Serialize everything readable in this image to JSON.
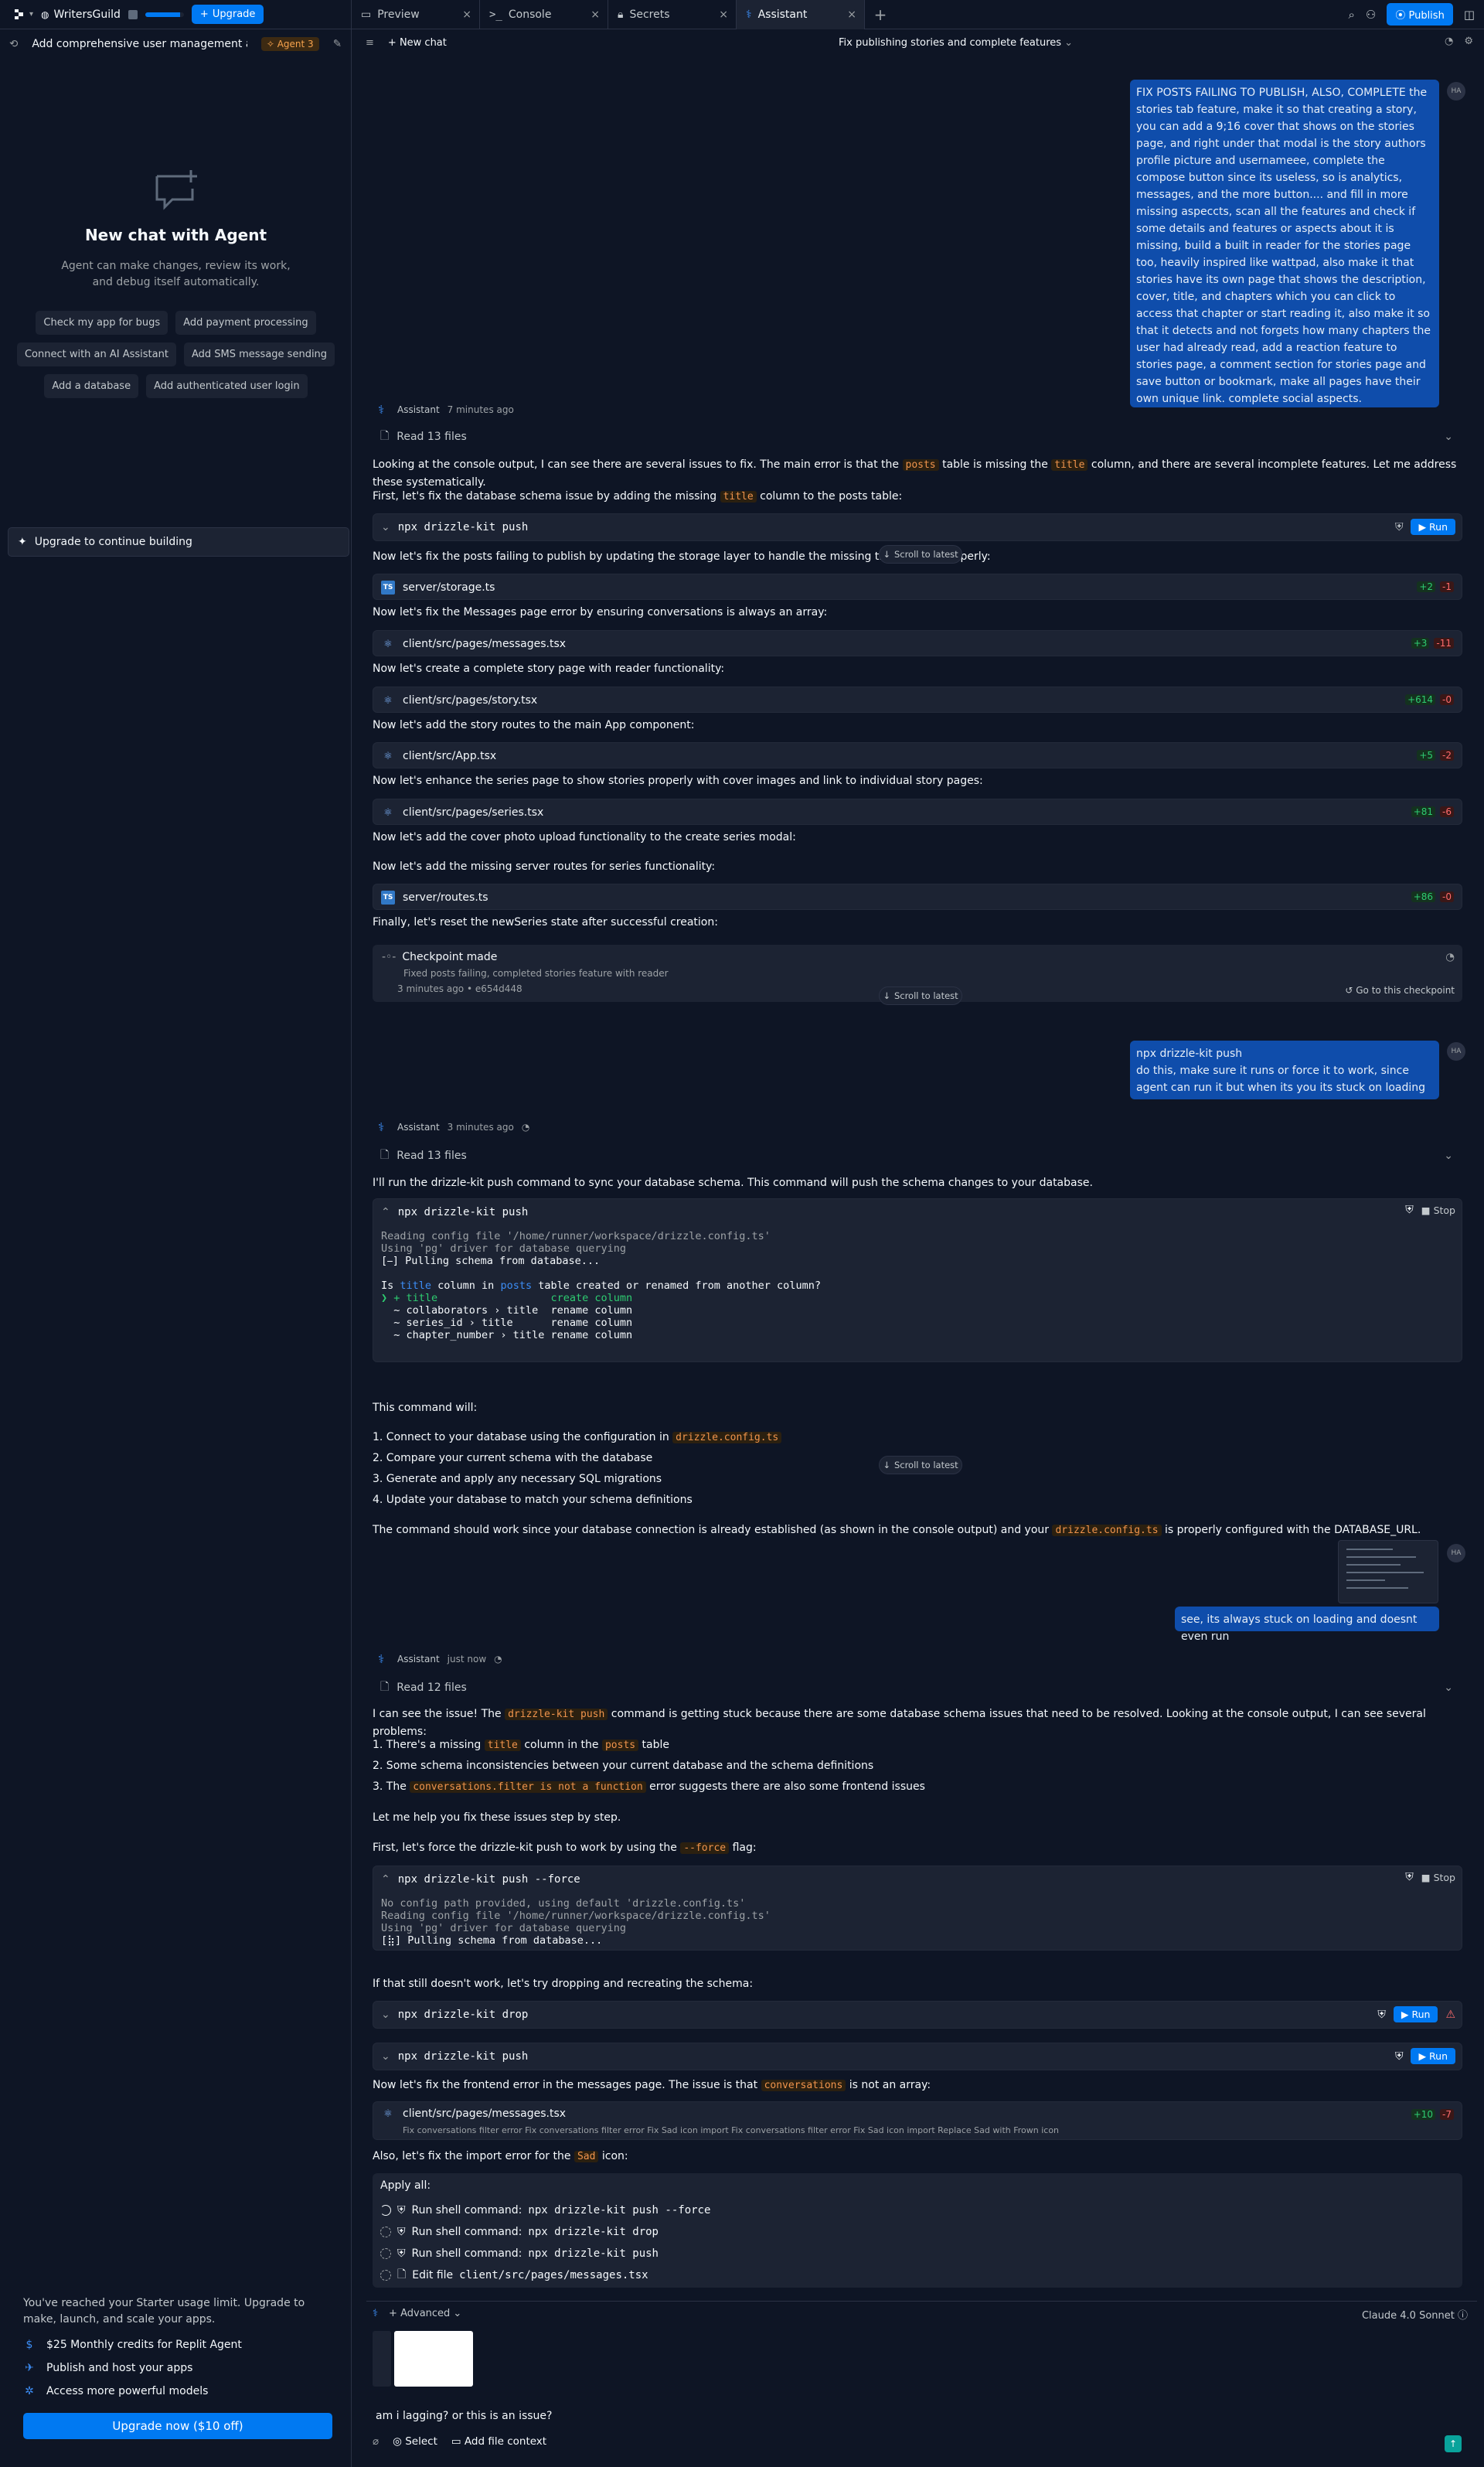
{
  "topbar": {
    "app_name": "WritersGuild",
    "upgrade_label": "Upgrade",
    "tabs": [
      {
        "label": "Preview",
        "icon": "preview-icon"
      },
      {
        "label": "Console",
        "icon": "terminal-icon"
      },
      {
        "label": "Secrets",
        "icon": "lock-icon"
      },
      {
        "label": "Assistant",
        "icon": "agent-icon"
      }
    ],
    "publish_label": "Publish",
    "progress": 0.9
  },
  "left": {
    "chat_title": "Add comprehensive user management a...",
    "agent_badge": "Agent 3",
    "new_chat_title": "New chat with Agent",
    "new_chat_sub": "Agent can make changes, review its work, and debug itself automatically.",
    "chips": [
      "Check my app for bugs",
      "Add payment processing",
      "Connect with an AI Assistant",
      "Add SMS message sending",
      "Add a database",
      "Add authenticated user login"
    ],
    "upgrade_continue": "Upgrade to continue building",
    "limit_text": "You've reached your Starter usage limit. Upgrade to make, launch, and scale your apps.",
    "features": [
      "$25 Monthly credits for Replit Agent",
      "Publish and host your apps",
      "Access more powerful models"
    ],
    "upgrade_now": "Upgrade now ($10 off)"
  },
  "main": {
    "new_chat": "New chat",
    "thread_title": "Fix publishing stories and complete features",
    "user_msg1": "FIX POSTS FAILING TO PUBLISH, ALSO, COMPLETE the stories tab feature, make it so that creating a story, you can add a 9;16 cover that shows on the stories page, and right under that modal is the story authors profile picture and usernameee, complete the compose button since its useless, so is analytics, messages, and the more button.... and fill in more missing aspeccts, scan all the features and check if some details and features or aspects about it is missing, build a built in reader for the stories page too, heavily inspired like wattpad, also make it that stories have its own page that shows the description, cover, title, and chapters which you can click to access that chapter or start reading it, also make it so that it detects and not forgets how many chapters the user had already read, add a reaction feature to stories page, a comment section for stories page and save button or bookmark, make all pages have their own unique link. complete social aspects.",
    "user_initials": "HA",
    "assistant_name": "Assistant",
    "time1": "7 minutes ago",
    "read1": "Read 13 files",
    "p1a": "Looking at the console output, I can see there are several issues to fix. The main error is that the ",
    "p1b": "posts",
    "p1c": " table is missing the ",
    "p1d": "title",
    "p1e": " column, and there are several incomplete features. Let me address these systematically.",
    "p2a": "First, let's fix the database schema issue by adding the missing ",
    "p2b": "title",
    "p2c": " column to the posts table:",
    "cmd_push": "npx drizzle-kit push",
    "run": "Run",
    "p3": "Now let's fix the posts failing to publish by updating the storage layer to handle the missing title column properly:",
    "scroll_latest": "Scroll to latest",
    "f_storage": "server/storage.ts",
    "f_storage_add": "+2",
    "f_storage_del": "-1",
    "p4": "Now let's fix the Messages page error by ensuring conversations is always an array:",
    "f_messages": "client/src/pages/messages.tsx",
    "f_messages_add": "+3",
    "f_messages_del": "-11",
    "p5": "Now let's create a complete story page with reader functionality:",
    "f_story": "client/src/pages/story.tsx",
    "f_story_add": "+614",
    "f_story_del": "-0",
    "p6": "Now let's add the story routes to the main App component:",
    "f_app": "client/src/App.tsx",
    "f_app_add": "+5",
    "f_app_del": "-2",
    "p7": "Now let's enhance the series page to show stories properly with cover images and link to individual story pages:",
    "f_series": "client/src/pages/series.tsx",
    "f_series_add": "+81",
    "f_series_del": "-6",
    "p8": "Now let's add the cover photo upload functionality to the create series modal:",
    "p9": "Now let's add the missing server routes for series functionality:",
    "f_routes": "server/routes.ts",
    "f_routes_add": "+86",
    "f_routes_del": "-0",
    "p10": "Finally, let's reset the newSeries state after successful creation:",
    "checkpoint": "Checkpoint made",
    "checkpoint_desc": "Fixed posts failing, completed stories feature with reader",
    "checkpoint_time": "3 minutes ago",
    "checkpoint_hash": "• e654d448",
    "goto_checkpoint": "Go to this checkpoint",
    "user_msg2_l1": "npx drizzle-kit push",
    "user_msg2_l2": "do this, make sure it runs or force it to work, since agent can run it but when its you its stuck on loading",
    "time2": "3 minutes ago",
    "read2": "Read 13 files",
    "p11": "I'll run the drizzle-kit push command to sync your database schema. This command will push the schema changes to your database.",
    "stop": "Stop",
    "term1": {
      "l1": "Reading config file '/home/runner/workspace/drizzle.config.ts'",
      "l2": "Using 'pg' driver for database querying",
      "l3": "[⎯] Pulling schema from database...",
      "q_a": "Is ",
      "q_b": "title",
      "q_c": " column in ",
      "q_d": "posts",
      "q_e": " table created or renamed from another column?",
      "o1": "❯ + title                  create column",
      "o2": "  ~ collaborators › title  rename column",
      "o3": "  ~ series_id › title      rename column",
      "o4": "  ~ chapter_number › title rename column"
    },
    "p12": "This command will:",
    "p12_1a": "1. Connect to your database using the configuration in ",
    "p12_1b": "drizzle.config.ts",
    "p12_2": "2. Compare your current schema with the database",
    "p12_3": "3. Generate and apply any necessary SQL migrations",
    "p12_4": "4. Update your database to match your schema definitions",
    "p13a": "The command should work since your database connection is already established (as shown in the console output) and your ",
    "p13b": "drizzle.config.ts",
    "p13c": " is properly configured with the DATABASE_URL.",
    "user_msg3": "see, its always stuck on loading and doesnt even run",
    "time3": "just now",
    "read3": "Read 12 files",
    "p14a": "I can see the issue! The ",
    "p14b": "drizzle-kit push",
    "p14c": " command is getting stuck because there are some database schema issues that need to be resolved. Looking at the console output, I can see several problems:",
    "p15a": "1. There's a missing ",
    "p15b": "title",
    "p15c": " column in the ",
    "p15d": "posts",
    "p15e": " table",
    "p16": "2. Some schema inconsistencies between your current database and the schema definitions",
    "p17a": "3. The ",
    "p17b": "conversations.filter is not a function",
    "p17c": " error suggests there are also some frontend issues",
    "p18": "Let me help you fix these issues step by step.",
    "p19a": "First, let's force the drizzle-kit push to work by using the ",
    "p19b": "--force",
    "p19c": " flag:",
    "cmd_force": "npx drizzle-kit push --force",
    "term2": {
      "l1": "No config path provided, using default 'drizzle.config.ts'",
      "l2": "Reading config file '/home/runner/workspace/drizzle.config.ts'",
      "l3": "Using 'pg' driver for database querying",
      "l4": "[⣷] Pulling schema from database..."
    },
    "p20": "If that still doesn't work, let's try dropping and recreating the schema:",
    "cmd_drop": "npx drizzle-kit drop",
    "p21a": "Now let's fix the frontend error in the messages page. The issue is that ",
    "p21b": "conversations",
    "p21c": " is not an array:",
    "f_messages2_add": "+10",
    "f_messages2_del": "-7",
    "f_messages2_desc": "Fix conversations filter error Fix conversations filter error Fix Sad icon import Fix conversations filter error Fix Sad icon import Replace Sad with Frown icon",
    "p22a": "Also, let's fix the import error for the ",
    "p22b": "Sad",
    "p22c": " icon:",
    "apply_all": "Apply all:",
    "apply_items": [
      {
        "pre": "Run shell command: ",
        "cmd": "npx drizzle-kit push --force"
      },
      {
        "pre": "Run shell command: ",
        "cmd": "npx drizzle-kit drop"
      },
      {
        "pre": "Run shell command: ",
        "cmd": "npx drizzle-kit push"
      },
      {
        "pre": "Edit file ",
        "cmd": "client/src/pages/messages.tsx"
      }
    ]
  },
  "composer": {
    "advanced": "Advanced",
    "model": "Claude 4.0 Sonnet",
    "text": "am i lagging? or this is an issue?",
    "select": "Select",
    "add_context": "Add file context"
  }
}
